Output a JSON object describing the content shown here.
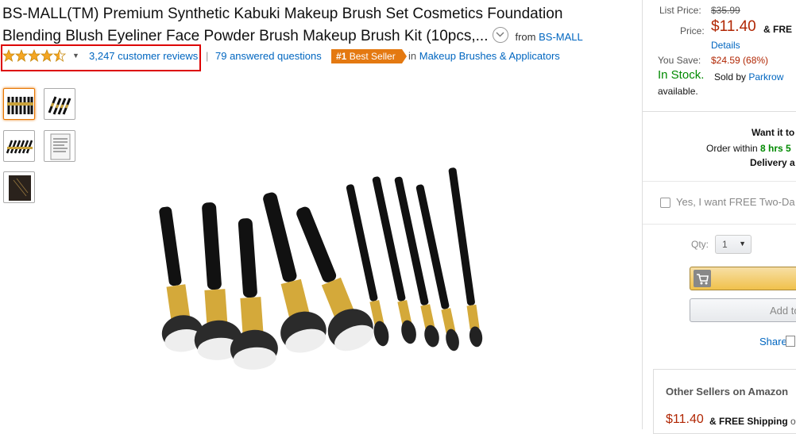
{
  "title": {
    "line1": "BS-MALL(TM) Premium Synthetic Kabuki Makeup Brush Set Cosmetics Foundation",
    "line2": "Blending Blush Eyeliner Face Powder Brush Makeup Brush Kit (10pcs,...",
    "from_label": "from",
    "brand": "BS-MALL"
  },
  "rating": {
    "stars": 4.5,
    "reviews": "3,247 customer reviews",
    "separator": "|",
    "answered": "79 answered questions"
  },
  "badge": {
    "rank": "#1",
    "text": "Best Seller",
    "in_label": "in",
    "category": "Makeup Brushes & Applicators"
  },
  "thumbnails": [
    {
      "label": "brush set front"
    },
    {
      "label": "brush set angled"
    },
    {
      "label": "brush set laid out"
    },
    {
      "label": "package card"
    },
    {
      "label": "brush pouch"
    }
  ],
  "price": {
    "list_label": "List Price:",
    "list_price": "$35.99",
    "price_label": "Price:",
    "price": "$11.40",
    "free_prefix": "& FRE",
    "details": "Details",
    "save_label": "You Save:",
    "save_amount": "$24.59 (68%)",
    "in_stock": "In Stock.",
    "sold_by_label": "Sold by",
    "seller": "Parkrow",
    "available": "available."
  },
  "buybox": {
    "want": "Want it to",
    "order_within_label": "Order within",
    "order_within_time": "8 hrs 5",
    "delivery": "Delivery a",
    "two_day": "Yes, I want FREE Two-Da",
    "qty_label": "Qty:",
    "qty_value": "1",
    "add_to_list": "Add to",
    "share": "Share"
  },
  "other_sellers": {
    "title": "Other Sellers on Amazon",
    "price": "$11.40",
    "shipping_prefix": "& FREE Shipping",
    "shipping_suffix": "on"
  },
  "colors": {
    "link": "#0066c0",
    "price": "#b12704",
    "in_stock": "#008a00",
    "badge": "#e47911",
    "highlight_box": "#dd0000"
  }
}
